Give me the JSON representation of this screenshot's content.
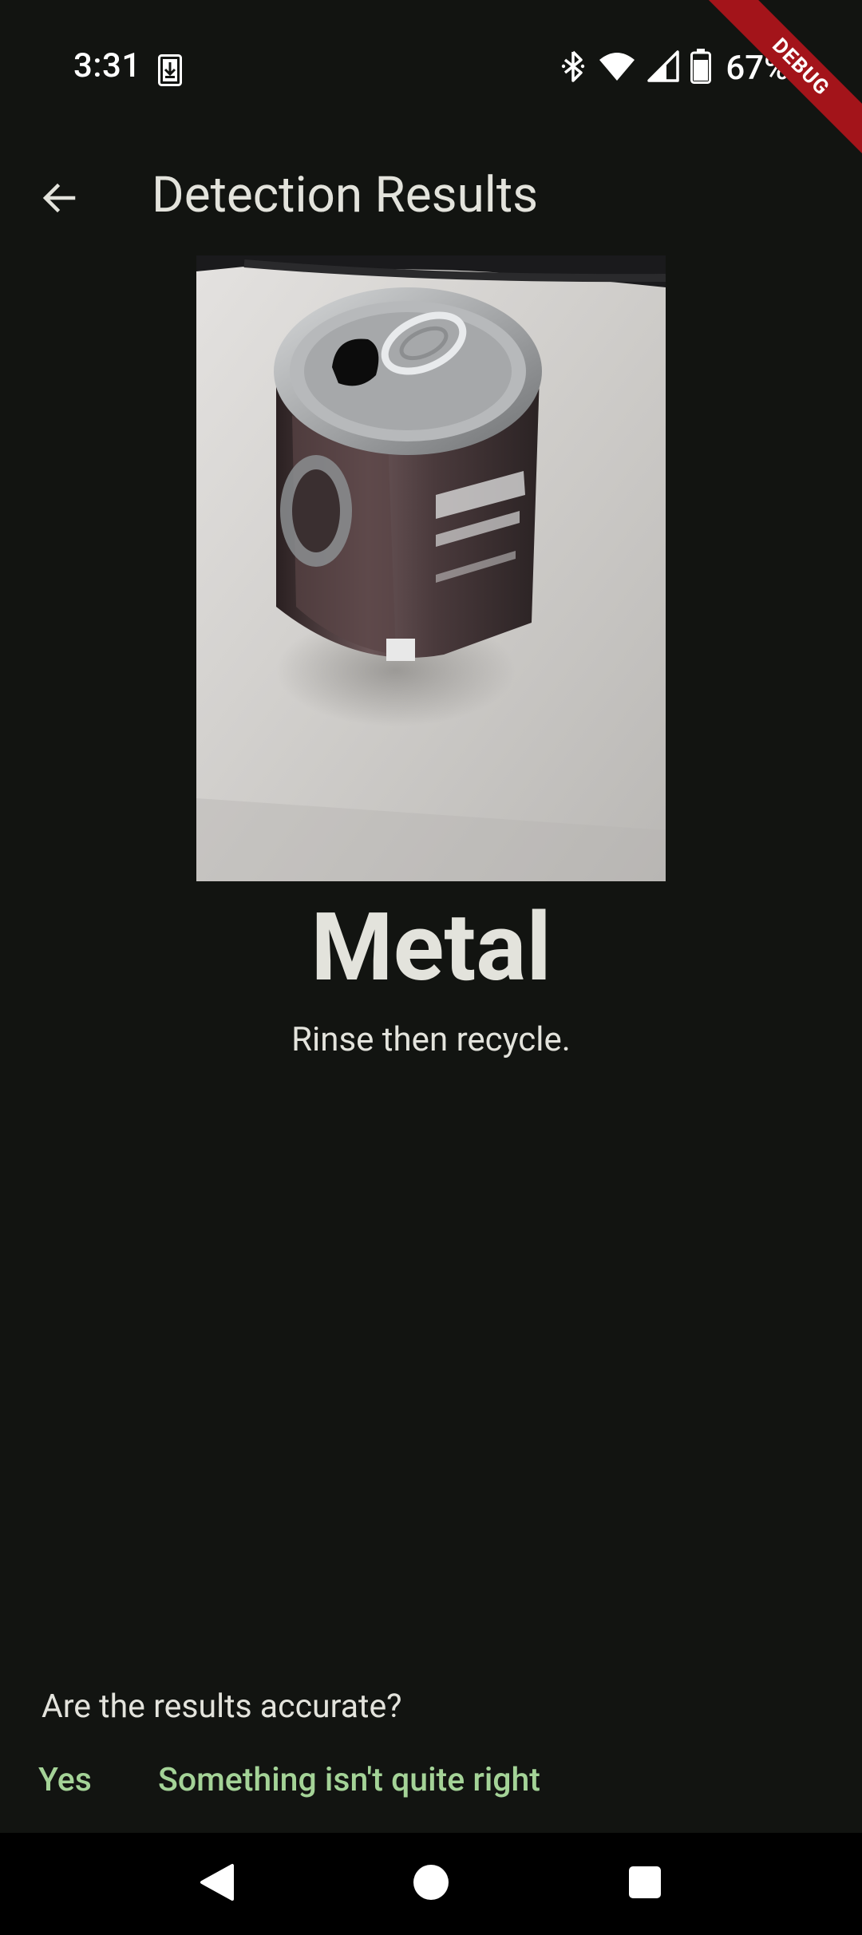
{
  "status_bar": {
    "time": "3:31",
    "battery_percent": "67%",
    "icons": [
      "download-icon",
      "bluetooth-icon",
      "wifi-icon",
      "signal-icon",
      "battery-icon"
    ]
  },
  "debug_banner": "DEBUG",
  "app_bar": {
    "title": "Detection Results",
    "back_icon": "arrow-back-icon"
  },
  "result": {
    "category": "Metal",
    "instruction": "Rinse then recycle."
  },
  "feedback": {
    "question": "Are the results accurate?",
    "yes_label": "Yes",
    "no_label": "Something isn't quite right"
  },
  "colors": {
    "background": "#121411",
    "text": "#e3e3dc",
    "accent": "#a4d397",
    "debug": "#a3141a"
  }
}
